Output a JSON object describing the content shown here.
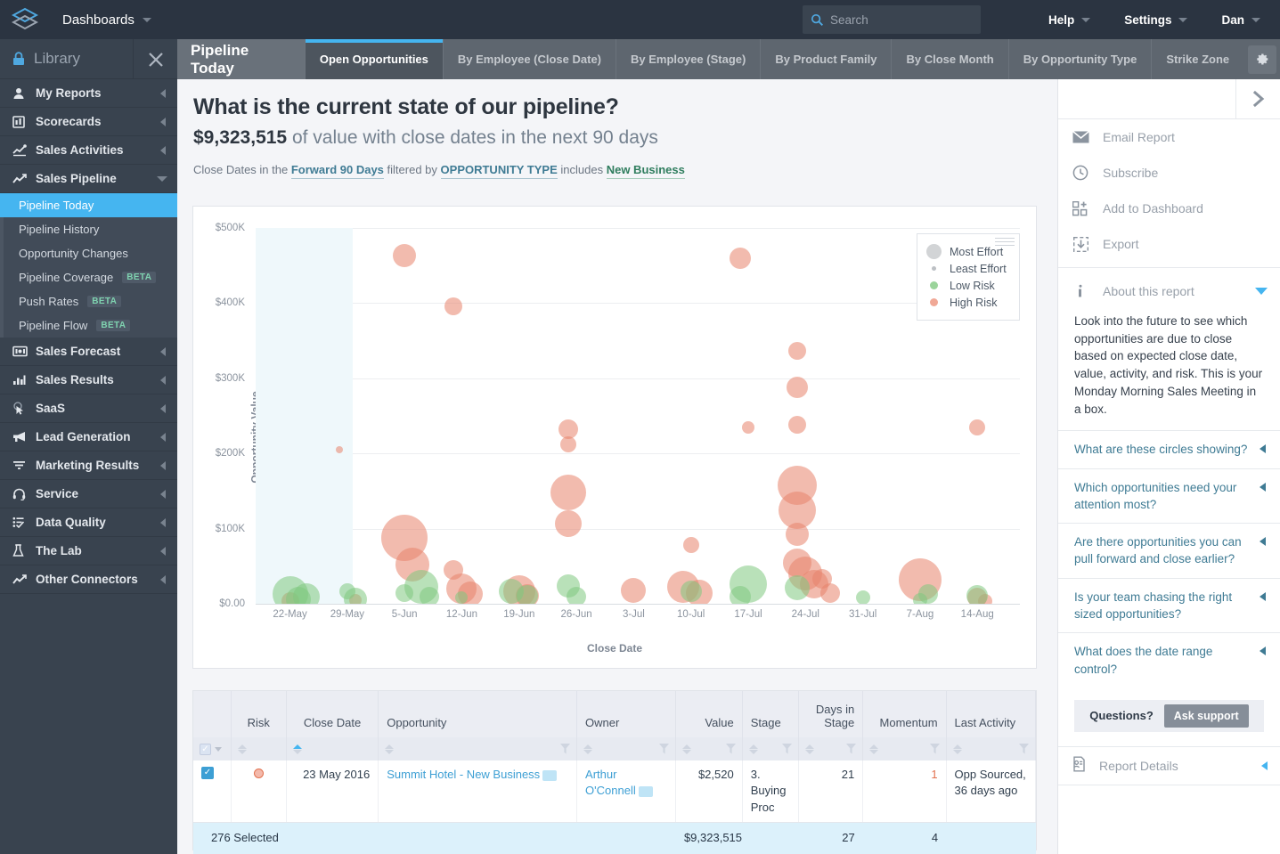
{
  "topbar": {
    "logo_icon": "layers-logo-icon",
    "dashboards_label": "Dashboards",
    "search": {
      "placeholder": "Search",
      "value": "",
      "icon": "search-icon"
    },
    "menus": [
      {
        "label": "Help"
      },
      {
        "label": "Settings"
      },
      {
        "label": "Dan"
      }
    ]
  },
  "sidebar": {
    "library_label": "Library",
    "lock_icon": "lock-icon",
    "close_icon": "close-icon",
    "items": [
      {
        "label": "My Reports",
        "icon": "person-icon",
        "state": "collapsed"
      },
      {
        "label": "Scorecards",
        "icon": "scorecard-icon",
        "state": "collapsed"
      },
      {
        "label": "Sales Activities",
        "icon": "activity-icon",
        "state": "collapsed"
      },
      {
        "label": "Sales Pipeline",
        "icon": "trendline-icon",
        "state": "expanded"
      },
      {
        "label": "Sales Forecast",
        "icon": "forecast-icon",
        "state": "collapsed"
      },
      {
        "label": "Sales Results",
        "icon": "barchart-icon",
        "state": "collapsed"
      },
      {
        "label": "SaaS",
        "icon": "cursor-icon",
        "state": "collapsed"
      },
      {
        "label": "Lead Generation",
        "icon": "megaphone-icon",
        "state": "collapsed"
      },
      {
        "label": "Marketing Results",
        "icon": "funnel-icon",
        "state": "collapsed"
      },
      {
        "label": "Service",
        "icon": "headset-icon",
        "state": "collapsed"
      },
      {
        "label": "Data Quality",
        "icon": "checklist-icon",
        "state": "collapsed"
      },
      {
        "label": "The Lab",
        "icon": "flask-icon",
        "state": "collapsed"
      },
      {
        "label": "Other Connectors",
        "icon": "trendline-icon",
        "state": "collapsed"
      }
    ],
    "subitems": [
      {
        "label": "Pipeline Today",
        "badge": "",
        "active": true
      },
      {
        "label": "Pipeline History",
        "badge": "",
        "active": false
      },
      {
        "label": "Opportunity Changes",
        "badge": "",
        "active": false
      },
      {
        "label": "Pipeline Coverage",
        "badge": "BETA",
        "active": false
      },
      {
        "label": "Push Rates",
        "badge": "BETA",
        "active": false
      },
      {
        "label": "Pipeline Flow",
        "badge": "BETA",
        "active": false
      }
    ]
  },
  "tabs": {
    "title": "Pipeline Today",
    "gear_icon": "gear-icon",
    "items": [
      {
        "label": "Open Opportunities",
        "active": true
      },
      {
        "label": "By Employee (Close Date)",
        "active": false
      },
      {
        "label": "By Employee (Stage)",
        "active": false
      },
      {
        "label": "By Product Family",
        "active": false
      },
      {
        "label": "By Close Month",
        "active": false
      },
      {
        "label": "By Opportunity Type",
        "active": false
      },
      {
        "label": "Strike Zone",
        "active": false
      }
    ]
  },
  "content": {
    "headline": "What is the current state of our pipeline?",
    "value": "$9,323,515",
    "value_suffix": "of value with close dates in the next 90 days",
    "filter_prefix": "Close Dates in the",
    "filter_range": "Forward 90 Days",
    "filter_mid": "filtered by",
    "filter_field": "OPPORTUNITY TYPE",
    "filter_op": "includes",
    "filter_value": "New Business"
  },
  "chart_data": {
    "type": "scatter",
    "title": "",
    "xlabel": "Close Date",
    "ylabel": "Opportunity Value",
    "ylim": [
      0,
      500000
    ],
    "yticks": [
      "$0.00",
      "$100K",
      "$200K",
      "$300K",
      "$400K",
      "$500K"
    ],
    "ytick_values": [
      0,
      100000,
      200000,
      300000,
      400000,
      500000
    ],
    "xticks": [
      "22-May",
      "29-May",
      "5-Jun",
      "12-Jun",
      "19-Jun",
      "26-Jun",
      "3-Jul",
      "10-Jul",
      "17-Jul",
      "24-Jul",
      "31-Jul",
      "7-Aug",
      "14-Aug"
    ],
    "grid": true,
    "legend_position": "top-right",
    "legend": [
      {
        "label": "Most Effort",
        "color": "#d2d4d6",
        "size": 17
      },
      {
        "label": "Least Effort",
        "color": "#bcc0c4",
        "size": 5
      },
      {
        "label": "Low Risk",
        "color": "#9bd49b",
        "size": 9
      },
      {
        "label": "High Risk",
        "color": "#f0a896",
        "size": 9
      }
    ],
    "shaded_region": {
      "from": "22-May",
      "to": "29-May",
      "color": "#eff8fb",
      "note": "past / highlighted date band"
    },
    "series": [
      {
        "name": "High Risk",
        "color": "#e8836b",
        "points": [
          {
            "x": "5-Jun",
            "y": 463000,
            "r": 13
          },
          {
            "x": "11-Jun",
            "y": 396000,
            "r": 10
          },
          {
            "x": "16-Jul",
            "y": 460000,
            "r": 12
          },
          {
            "x": "23-Jul",
            "y": 337000,
            "r": 10
          },
          {
            "x": "23-Jul",
            "y": 288000,
            "r": 12
          },
          {
            "x": "23-Jul",
            "y": 238000,
            "r": 10
          },
          {
            "x": "17-Jul",
            "y": 235000,
            "r": 7
          },
          {
            "x": "28-May",
            "y": 205000,
            "r": 4
          },
          {
            "x": "25-Jun",
            "y": 232000,
            "r": 11
          },
          {
            "x": "25-Jun",
            "y": 212000,
            "r": 9
          },
          {
            "x": "14-Aug",
            "y": 235000,
            "r": 9
          },
          {
            "x": "25-Jun",
            "y": 148000,
            "r": 20
          },
          {
            "x": "25-Jun",
            "y": 107000,
            "r": 15
          },
          {
            "x": "23-Jul",
            "y": 157000,
            "r": 22
          },
          {
            "x": "23-Jul",
            "y": 125000,
            "r": 21
          },
          {
            "x": "23-Jul",
            "y": 92000,
            "r": 13
          },
          {
            "x": "5-Jun",
            "y": 88000,
            "r": 26
          },
          {
            "x": "6-Jun",
            "y": 52000,
            "r": 19
          },
          {
            "x": "11-Jun",
            "y": 45000,
            "r": 11
          },
          {
            "x": "10-Jul",
            "y": 78000,
            "r": 9
          },
          {
            "x": "23-Jul",
            "y": 55000,
            "r": 16
          },
          {
            "x": "24-Jul",
            "y": 40000,
            "r": 19
          },
          {
            "x": "25-Jul",
            "y": 26000,
            "r": 16
          },
          {
            "x": "26-Jul",
            "y": 33000,
            "r": 11
          },
          {
            "x": "7-Aug",
            "y": 32000,
            "r": 24
          },
          {
            "x": "12-Jun",
            "y": 20000,
            "r": 17
          },
          {
            "x": "13-Jun",
            "y": 13000,
            "r": 14
          },
          {
            "x": "19-Jun",
            "y": 16000,
            "r": 18
          },
          {
            "x": "20-Jun",
            "y": 11000,
            "r": 13
          },
          {
            "x": "3-Jul",
            "y": 18000,
            "r": 14
          },
          {
            "x": "9-Jul",
            "y": 22000,
            "r": 18
          },
          {
            "x": "11-Jul",
            "y": 14000,
            "r": 15
          },
          {
            "x": "27-Jul",
            "y": 14000,
            "r": 11
          },
          {
            "x": "14-Aug",
            "y": 8000,
            "r": 11
          },
          {
            "x": "15-Aug",
            "y": 4000,
            "r": 8
          },
          {
            "x": "22-May",
            "y": 4000,
            "r": 10
          },
          {
            "x": "30-May",
            "y": 5000,
            "r": 7
          }
        ]
      },
      {
        "name": "Low Risk",
        "color": "#7fc97f",
        "points": [
          {
            "x": "22-May",
            "y": 13000,
            "r": 20
          },
          {
            "x": "23-May",
            "y": 6000,
            "r": 14
          },
          {
            "x": "24-May",
            "y": 9000,
            "r": 15
          },
          {
            "x": "29-May",
            "y": 17000,
            "r": 9
          },
          {
            "x": "30-May",
            "y": 6000,
            "r": 13
          },
          {
            "x": "5-Jun",
            "y": 14000,
            "r": 10
          },
          {
            "x": "7-Jun",
            "y": 22000,
            "r": 19
          },
          {
            "x": "8-Jun",
            "y": 9000,
            "r": 11
          },
          {
            "x": "12-Jun",
            "y": 8000,
            "r": 7
          },
          {
            "x": "18-Jun",
            "y": 16000,
            "r": 14
          },
          {
            "x": "20-Jun",
            "y": 11000,
            "r": 12
          },
          {
            "x": "25-Jun",
            "y": 24000,
            "r": 13
          },
          {
            "x": "26-Jun",
            "y": 9000,
            "r": 11
          },
          {
            "x": "10-Jul",
            "y": 17000,
            "r": 12
          },
          {
            "x": "17-Jul",
            "y": 26000,
            "r": 21
          },
          {
            "x": "16-Jul",
            "y": 9000,
            "r": 12
          },
          {
            "x": "23-Jul",
            "y": 21000,
            "r": 14
          },
          {
            "x": "31-Jul",
            "y": 8000,
            "r": 8
          },
          {
            "x": "7-Aug",
            "y": 5000,
            "r": 8
          },
          {
            "x": "8-Aug",
            "y": 13000,
            "r": 11
          },
          {
            "x": "14-Aug",
            "y": 11000,
            "r": 12
          }
        ]
      }
    ]
  },
  "table": {
    "columns": [
      "",
      "Risk",
      "Close Date",
      "Opportunity",
      "Owner",
      "Value",
      "Stage",
      "Days in Stage",
      "Momentum",
      "Last Activity"
    ],
    "sorted_column": "Close Date",
    "sort_direction": "asc",
    "rows": [
      {
        "checked": true,
        "risk": "high",
        "close_date": "23 May 2016",
        "opportunity": "Summit Hotel - New Business",
        "owner": "Arthur O'Connell",
        "value": "$2,520",
        "stage": "3. Buying Proc",
        "days_in_stage": "21",
        "momentum": "1",
        "last_activity": "Opp Sourced, 36 days ago"
      }
    ],
    "summary": {
      "selected": "276 Selected",
      "value": "$9,323,515",
      "days_in_stage": "27",
      "momentum": "4"
    }
  },
  "rightpanel": {
    "collapse_icon": "chevron-right-icon",
    "actions": [
      {
        "label": "Email Report",
        "icon": "envelope-icon"
      },
      {
        "label": "Subscribe",
        "icon": "clock-icon"
      },
      {
        "label": "Add to Dashboard",
        "icon": "add-widget-icon"
      },
      {
        "label": "Export",
        "icon": "export-icon"
      }
    ],
    "about_label": "About this report",
    "about_icon": "info-icon",
    "description": "Look into the future to see which opportunities are due to close based on expected close date, value, activity, and risk. This is your Monday Morning Sales Meeting in a box.",
    "questions": [
      "What are these circles showing?",
      "Which opportunities need your attention most?",
      "Are there opportunities you can pull forward and close earlier?",
      "Is your team chasing the right sized opportunities?",
      "What does the date range control?"
    ],
    "support_prompt": "Questions?",
    "support_button": "Ask support",
    "report_details_label": "Report Details",
    "report_details_icon": "report-icon"
  }
}
